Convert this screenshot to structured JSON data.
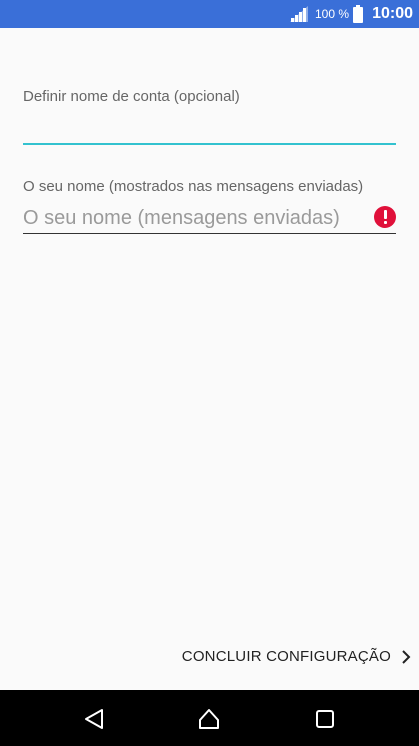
{
  "status": {
    "battery_pct": "100 %",
    "time": "10:00",
    "signal_icon": "cellular-signal-icon",
    "battery_icon": "battery-icon"
  },
  "form": {
    "account_name_label": "Definir nome de conta (opcional)",
    "account_name_value": "",
    "your_name_label": "O seu nome (mostrados nas mensagens enviadas)",
    "your_name_placeholder": "O seu nome (mensagens enviadas)",
    "your_name_value": "",
    "error_icon": "error-icon"
  },
  "actions": {
    "finish_label": "CONCLUIR CONFIGURAÇÃO"
  },
  "colors": {
    "status_bar": "#3a6fd8",
    "accent": "#33c2cf",
    "error": "#e0103a",
    "nav_bar": "#000000"
  },
  "nav": {
    "back_icon": "back-icon",
    "home_icon": "home-icon",
    "recent_icon": "recent-apps-icon"
  }
}
